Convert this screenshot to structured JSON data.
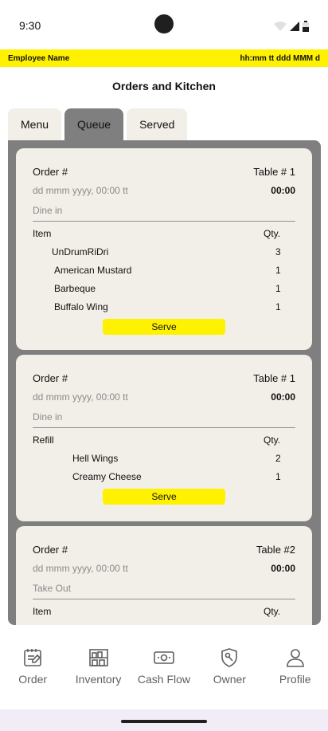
{
  "status": {
    "time": "9:30"
  },
  "header": {
    "employee": "Employee Name",
    "datetime": "hh:mm tt ddd MMM d"
  },
  "page_title": "Orders and Kitchen",
  "tabs": [
    {
      "label": "Menu"
    },
    {
      "label": "Queue"
    },
    {
      "label": "Served"
    }
  ],
  "orders": [
    {
      "order_label": "Order #",
      "table_label": "Table # 1",
      "date": "dd mmm yyyy, 00:00 tt",
      "time": "00:00",
      "type": "Dine in",
      "items_header": "Item",
      "qty_header": "Qty.",
      "items": [
        {
          "name": "UnDrumRiDri",
          "qty": "3"
        },
        {
          "name": "American Mustard",
          "qty": "1"
        },
        {
          "name": "Barbeque",
          "qty": "1"
        },
        {
          "name": "Buffalo Wing",
          "qty": "1"
        }
      ],
      "button": "Serve"
    },
    {
      "order_label": "Order #",
      "table_label": "Table # 1",
      "date": "dd mmm yyyy, 00:00 tt",
      "time": "00:00",
      "type": "Dine in",
      "items_header": "Refill",
      "qty_header": "Qty.",
      "items": [
        {
          "name": "Hell Wings",
          "qty": "2"
        },
        {
          "name": "Creamy Cheese",
          "qty": "1"
        }
      ],
      "button": "Serve"
    },
    {
      "order_label": "Order #",
      "table_label": "Table #2",
      "date": "dd mmm yyyy, 00:00 tt",
      "time": "00:00",
      "type": "Take Out",
      "items_header": "Item",
      "qty_header": "Qty."
    }
  ],
  "nav": [
    {
      "label": "Order",
      "icon": "order-icon"
    },
    {
      "label": "Inventory",
      "icon": "inventory-icon"
    },
    {
      "label": "Cash Flow",
      "icon": "cash-flow-icon"
    },
    {
      "label": "Owner",
      "icon": "owner-icon"
    },
    {
      "label": "Profile",
      "icon": "profile-icon"
    }
  ],
  "colors": {
    "accent": "#fff200",
    "panel": "#7f7f7f",
    "card": "#f2efe8",
    "muted": "#8a8a8a"
  }
}
